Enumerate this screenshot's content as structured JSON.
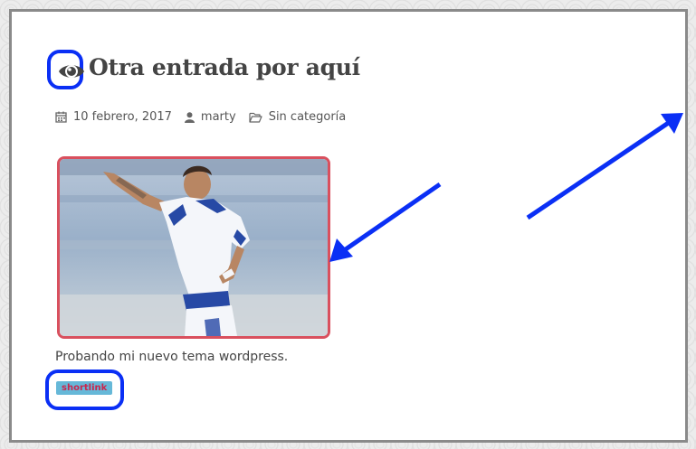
{
  "post": {
    "title": "Otra entrada por aquí",
    "date": "10 febrero, 2017",
    "author": "marty",
    "category": "Sin categoría",
    "excerpt": "Probando mi nuevo tema wordpress.",
    "shortlink_label": "shortlink"
  },
  "icons": {
    "title_icon": "eye-icon",
    "date_icon": "calendar-icon",
    "author_icon": "user-icon",
    "category_icon": "folder-icon"
  },
  "colors": {
    "annotation": "#0a2ff5",
    "image_border": "#d9505e",
    "shortlink_bg": "#66b8d8",
    "shortlink_text": "#c9254c"
  }
}
